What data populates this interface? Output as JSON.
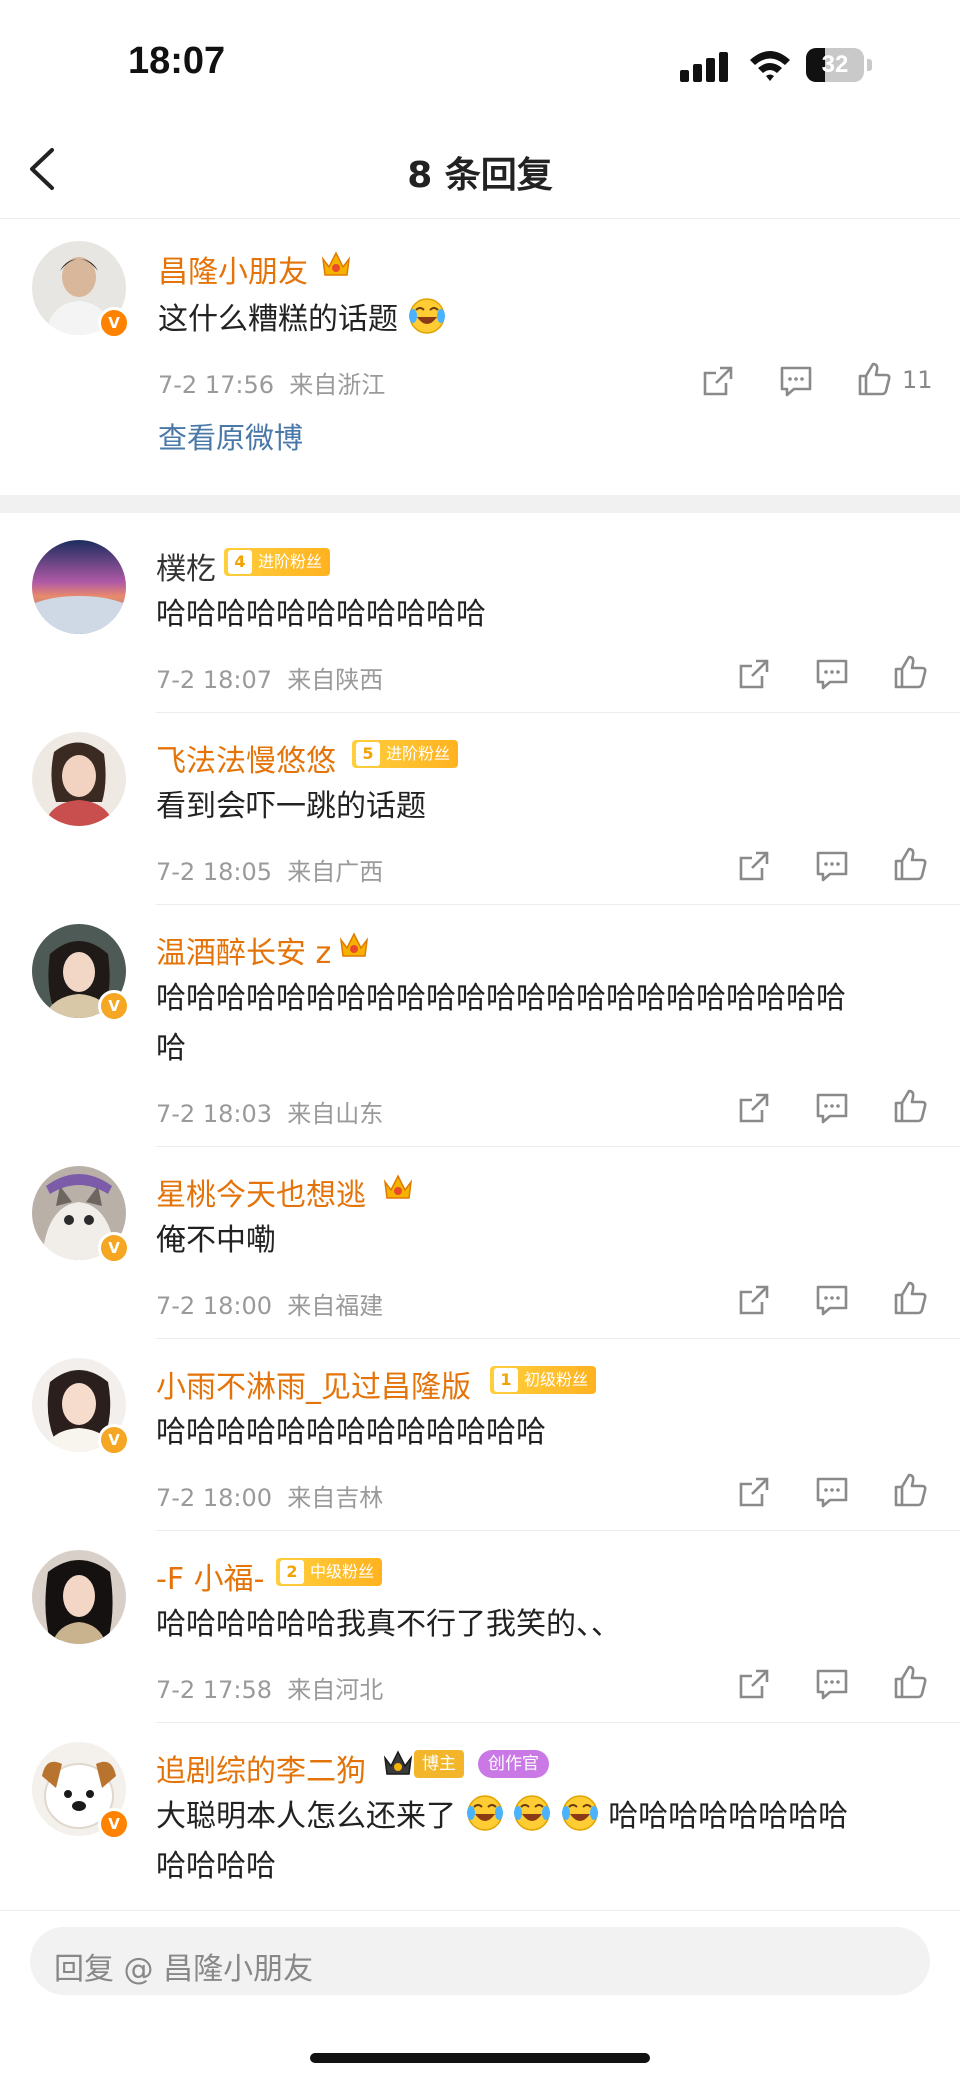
{
  "status_bar": {
    "time": "18:07",
    "battery": "32"
  },
  "nav": {
    "title": "8 条回复"
  },
  "top_comment": {
    "username": "昌隆小朋友",
    "text": "这什么糟糕的话题",
    "time": "7-2 17:56",
    "location": "来自浙江",
    "like_count": "11",
    "view_original": "查看原微博"
  },
  "replies": [
    {
      "username": "樸杚",
      "badge_level": "4",
      "badge_text": "进阶粉丝",
      "text": "哈哈哈哈哈哈哈哈哈哈哈",
      "time": "7-2 18:07",
      "location": "来自陕西"
    },
    {
      "username": "飞法法慢悠悠",
      "badge_level": "5",
      "badge_text": "进阶粉丝",
      "text": "看到会吓一跳的话题",
      "time": "7-2 18:05",
      "location": "来自广西"
    },
    {
      "username": "温酒醉长安 z",
      "text_line1": "哈哈哈哈哈哈哈哈哈哈哈哈哈哈哈哈哈哈哈哈哈哈哈",
      "text_line2": "哈",
      "time": "7-2 18:03",
      "location": "来自山东"
    },
    {
      "username": "星桃今天也想逃",
      "text": "俺不中嘞",
      "time": "7-2 18:00",
      "location": "来自福建"
    },
    {
      "username": "小雨不淋雨_见过昌隆版",
      "badge_level": "1",
      "badge_text": "初级粉丝",
      "text": "哈哈哈哈哈哈哈哈哈哈哈哈哈",
      "time": "7-2 18:00",
      "location": "来自吉林"
    },
    {
      "username": "-F 小福-",
      "badge_level": "2",
      "badge_text": "中级粉丝",
      "text": "哈哈哈哈哈哈我真不行了我笑的、、",
      "time": "7-2 17:58",
      "location": "来自河北"
    },
    {
      "username": "追剧综的李二狗",
      "blogger_badge": "博主",
      "creator_badge": "创作官",
      "text_line1": "大聪明本人怎么还来了",
      "text_line1_tail": "哈哈哈哈哈哈哈哈",
      "text_line2": "哈哈哈哈"
    }
  ],
  "reply_input": {
    "placeholder": "回复 @ 昌隆小朋友"
  },
  "colors": {
    "username": "#e4740a",
    "link": "#4a78a8",
    "meta": "#9a9a9a",
    "fan_badge": "#ffb21f",
    "verify_badge": "#f5a623"
  },
  "icons": [
    "back-arrow-icon",
    "share-icon",
    "comment-icon",
    "like-icon",
    "crown-icon",
    "laughing-cry-emoji-icon"
  ]
}
